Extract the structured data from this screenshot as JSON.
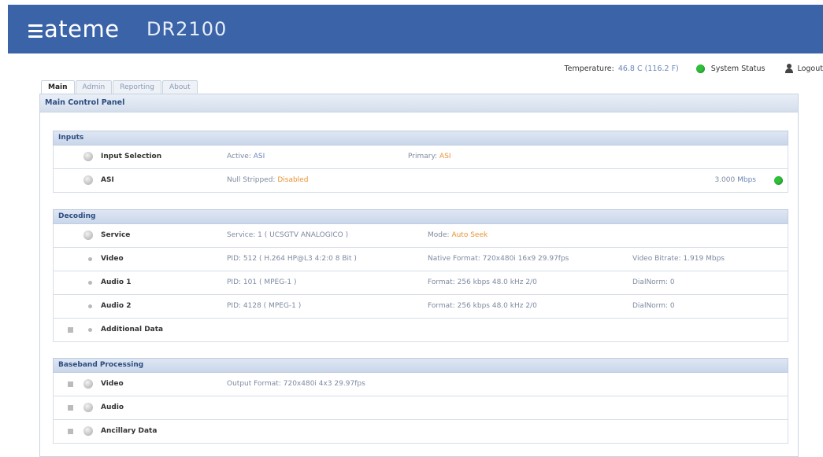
{
  "brand": {
    "logo": "ateme",
    "product": "DR2100"
  },
  "topbar": {
    "temperature_label": "Temperature:",
    "temperature_value": "46.8 C (116.2 F)",
    "system_status": "System Status",
    "logout": "Logout",
    "status_color": "#2fbf3a"
  },
  "tabs": [
    {
      "label": "Main",
      "active": true
    },
    {
      "label": "Admin",
      "active": false
    },
    {
      "label": "Reporting",
      "active": false
    },
    {
      "label": "About",
      "active": false
    }
  ],
  "panel_title": "Main Control Panel",
  "inputs": {
    "header": "Inputs",
    "input_selection": {
      "name": "Input Selection",
      "active_label": "Active:",
      "active_value": "ASI",
      "primary_label": "Primary:",
      "primary_value": "ASI"
    },
    "asi": {
      "name": "ASI",
      "null_label": "Null Stripped:",
      "null_value": "Disabled",
      "rate_value": "3.000",
      "rate_unit": "Mbps"
    }
  },
  "decoding": {
    "header": "Decoding",
    "service": {
      "name": "Service",
      "service_label": "Service:",
      "service_value": "1 ( UCSGTV ANALOGICO )",
      "mode_label": "Mode:",
      "mode_value": "Auto Seek"
    },
    "video": {
      "name": "Video",
      "pid_label": "PID:",
      "pid_value": "512 ( H.264   HP@L3   4:2:0 8 Bit )",
      "format_label": "Native Format:",
      "format_value": "720x480i 16x9 29.97fps",
      "bitrate_label": "Video Bitrate:",
      "bitrate_value": "1.919 Mbps"
    },
    "audio1": {
      "name": "Audio 1",
      "pid_label": "PID:",
      "pid_value": "101 ( MPEG-1 )",
      "format_label": "Format:",
      "format_value": "256 kbps   48.0 kHz   2/0",
      "dialnorm_label": "DialNorm:",
      "dialnorm_value": "0"
    },
    "audio2": {
      "name": "Audio 2",
      "pid_label": "PID:",
      "pid_value": "4128 ( MPEG-1 )",
      "format_label": "Format:",
      "format_value": "256 kbps   48.0 kHz   2/0",
      "dialnorm_label": "DialNorm:",
      "dialnorm_value": "0"
    },
    "additional": {
      "name": "Additional Data"
    }
  },
  "baseband": {
    "header": "Baseband Processing",
    "video": {
      "name": "Video",
      "format_label": "Output Format:",
      "format_value": "720x480i 4x3 29.97fps"
    },
    "audio": {
      "name": "Audio"
    },
    "ancillary": {
      "name": "Ancillary Data"
    }
  }
}
